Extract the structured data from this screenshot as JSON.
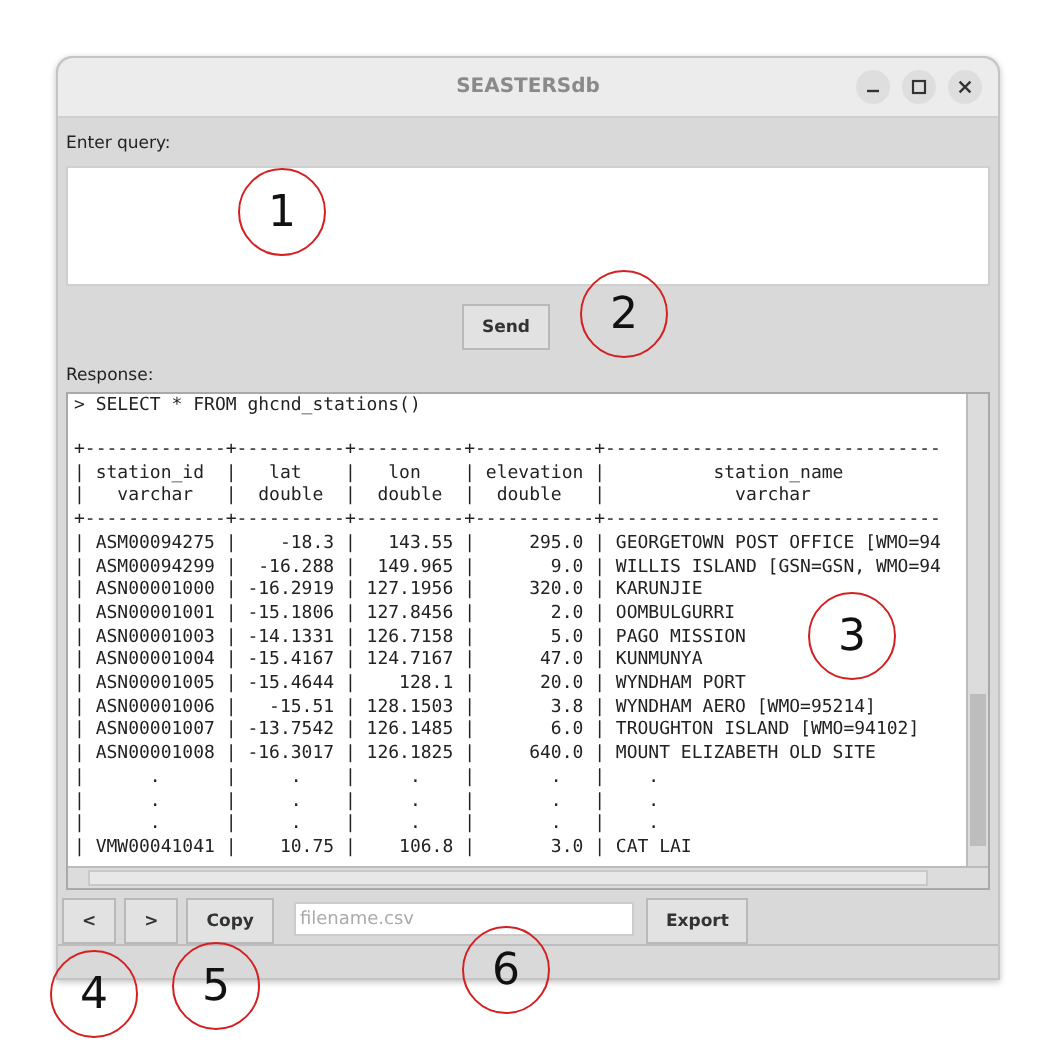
{
  "window": {
    "title": "SEASTERSdb"
  },
  "query": {
    "label": "Enter query:"
  },
  "send_button": "Send",
  "response": {
    "label": "Response:",
    "command": "> SELECT * FROM ghcnd_stations()",
    "lines": [
      "+-------------+----------+----------+-----------+-------------------------------",
      "| station_id  |   lat    |   lon    | elevation |          station_name",
      "|   varchar   |  double  |  double  |  double   |            varchar",
      "+-------------+----------+----------+-----------+-------------------------------",
      "| ASM00094275 |    -18.3 |   143.55 |     295.0 | GEORGETOWN POST OFFICE [WMO=94",
      "| ASM00094299 |  -16.288 |  149.965 |       9.0 | WILLIS ISLAND [GSN=GSN, WMO=94",
      "| ASN00001000 | -16.2919 | 127.1956 |     320.0 | KARUNJIE",
      "| ASN00001001 | -15.1806 | 127.8456 |       2.0 | OOMBULGURRI",
      "| ASN00001003 | -14.1331 | 126.7158 |       5.0 | PAGO MISSION",
      "| ASN00001004 | -15.4167 | 124.7167 |      47.0 | KUNMUNYA",
      "| ASN00001005 | -15.4644 |    128.1 |      20.0 | WYNDHAM PORT",
      "| ASN00001006 |   -15.51 | 128.1503 |       3.8 | WYNDHAM AERO [WMO=95214]",
      "| ASN00001007 | -13.7542 | 126.1485 |       6.0 | TROUGHTON ISLAND [WMO=94102]",
      "| ASN00001008 | -16.3017 | 126.1825 |     640.0 | MOUNT ELIZABETH OLD SITE",
      "|      .      |     .    |     .    |       .   |    .",
      "|      .      |     .    |     .    |       .   |    .",
      "|      .      |     .    |     .    |       .   |    .",
      "| VMW00041041 |    10.75 |    106.8 |       3.0 | CAT LAI"
    ]
  },
  "toolbar": {
    "prev_button": "<",
    "next_button": ">",
    "copy_button": "Copy",
    "filename_field": {
      "placeholder": "filename.csv"
    },
    "export_button": "Export"
  },
  "callouts": [
    "1",
    "2",
    "3",
    "4",
    "5",
    "6"
  ]
}
